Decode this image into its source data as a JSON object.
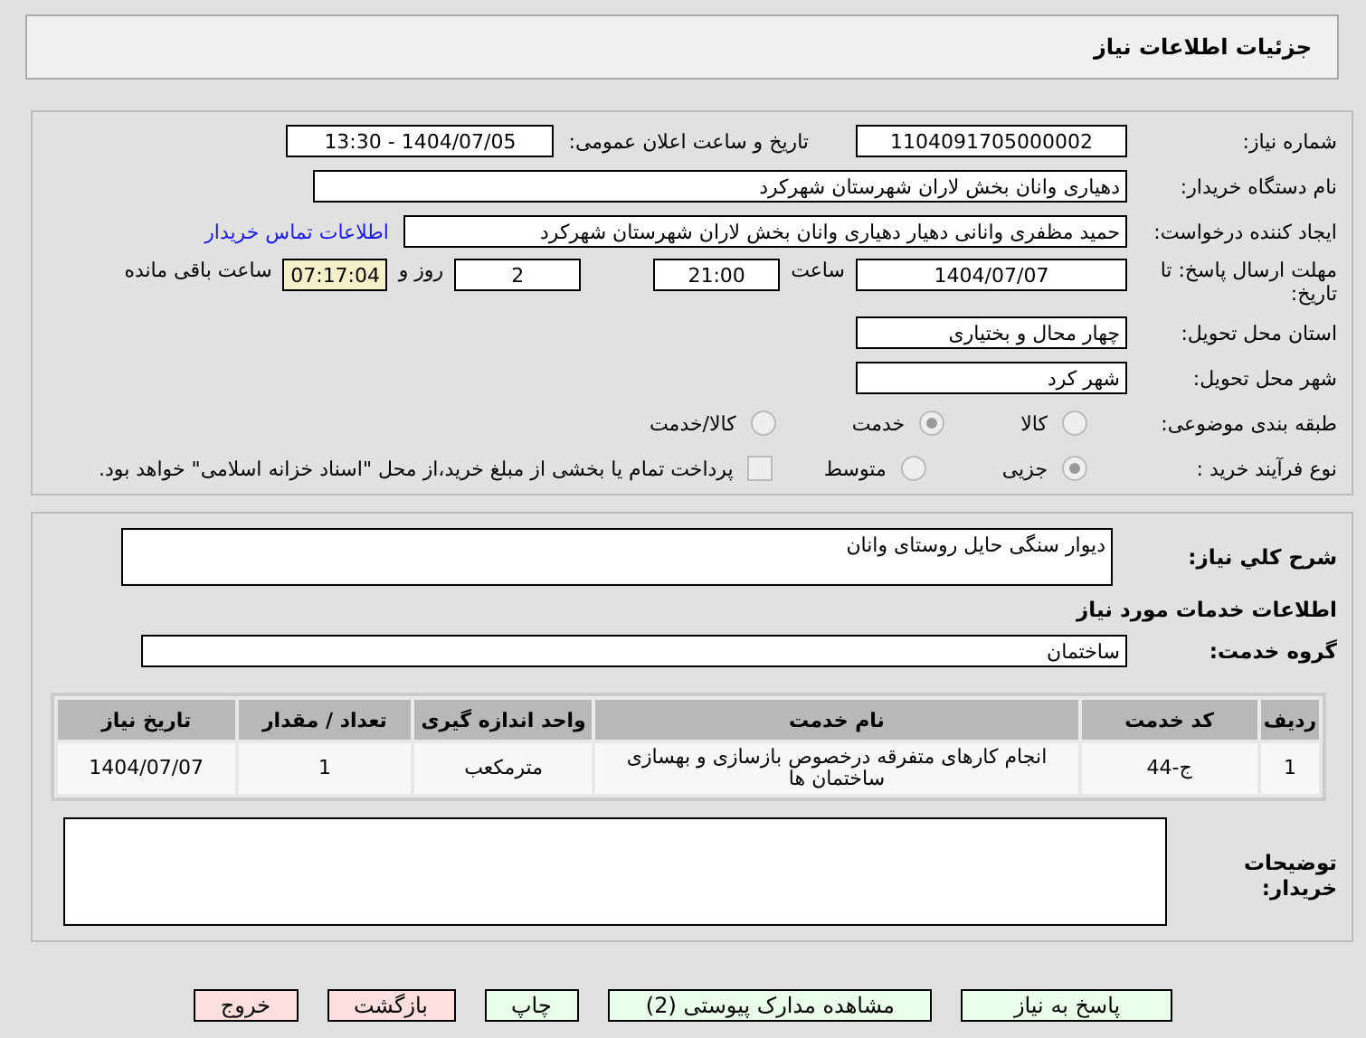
{
  "header": {
    "title": "جزئیات اطلاعات نیاز"
  },
  "need_number": {
    "label": "شماره نیاز:",
    "value": "1104091705000002"
  },
  "announce": {
    "label": "تاریخ و ساعت اعلان عمومی:",
    "value": "1404/07/05 - 13:30"
  },
  "buyer_org": {
    "label": "نام دستگاه خریدار:",
    "value": "دهیاری وانان بخش لاران شهرستان شهرکرد"
  },
  "requester": {
    "label": "ایجاد کننده درخواست:",
    "value": "حمید مظفری وانانی دهیار دهیاری وانان بخش لاران شهرستان شهرکرد",
    "link": "اطلاعات تماس خریدار"
  },
  "deadline": {
    "label": "مهلت ارسال پاسخ: تا تاریخ:",
    "date": "1404/07/07",
    "time_label": "ساعت",
    "time": "21:00",
    "days": "2",
    "days_label": "روز و",
    "remaining": "07:17:04",
    "remaining_label": "ساعت باقی مانده"
  },
  "province": {
    "label": "استان محل تحویل:",
    "value": "چهار محال و بختیاری"
  },
  "city": {
    "label": "شهر محل تحویل:",
    "value": "شهر کرد"
  },
  "category": {
    "label": "طبقه بندی موضوعی:",
    "options": [
      {
        "label": "کالا",
        "selected": false
      },
      {
        "label": "خدمت",
        "selected": true
      },
      {
        "label": "کالا/خدمت",
        "selected": false
      }
    ]
  },
  "purchase_type": {
    "label": "نوع فرآیند خرید :",
    "options": [
      {
        "label": "جزیی",
        "selected": true
      },
      {
        "label": "متوسط",
        "selected": false
      }
    ],
    "checkbox": {
      "label": "پرداخت تمام یا بخشی از مبلغ خرید،از محل \"اسناد خزانه اسلامی\" خواهد بود.",
      "checked": false
    }
  },
  "description": {
    "label": "شرح کلي نياز:",
    "value": "دیوار سنگی حایل روستای وانان"
  },
  "services_title": "اطلاعات خدمات مورد نیاز",
  "service_group": {
    "label": "گروه خدمت:",
    "value": "ساختمان"
  },
  "table": {
    "columns": [
      "ردیف",
      "کد خدمت",
      "نام خدمت",
      "واحد اندازه گیری",
      "تعداد / مقدار",
      "تاریخ نیاز"
    ],
    "rows": [
      [
        "1",
        "ج-44",
        "انجام کارهای متفرقه درخصوص بازسازی و بهسازی ساختمان ها",
        "مترمکعب",
        "1",
        "1404/07/07"
      ]
    ]
  },
  "buyer_notes": {
    "label": "توضیحات خریدار:"
  },
  "buttons": [
    {
      "label": "پاسخ به نیاز",
      "color": "#eaffea"
    },
    {
      "label": "مشاهده مدارک پیوستی (2)",
      "color": "#eaffea"
    },
    {
      "label": "چاپ",
      "color": "#eaffea"
    },
    {
      "label": "بازگشت",
      "color": "#ffdede"
    },
    {
      "label": "خروج",
      "color": "#ffdede"
    }
  ]
}
